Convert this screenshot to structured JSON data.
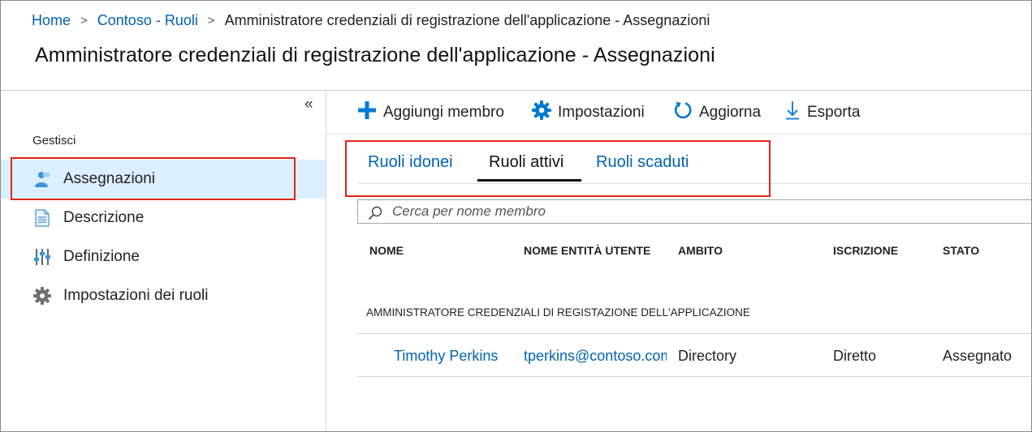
{
  "breadcrumb": {
    "home": "Home",
    "parent": "Contoso - Ruoli",
    "current": "Amministratore credenziali di registrazione dell'applicazione - Assegnazioni",
    "separator": ">"
  },
  "page_title": "Amministratore credenziali di registrazione dell'applicazione - Assegnazioni",
  "sidebar": {
    "collapse_glyph": "«",
    "section": "Gestisci",
    "items": [
      {
        "label": "Assegnazioni",
        "icon": "user-icon",
        "active": true
      },
      {
        "label": "Descrizione",
        "icon": "document-icon",
        "active": false
      },
      {
        "label": "Definizione",
        "icon": "sliders-icon",
        "active": false
      },
      {
        "label": "Impostazioni dei ruoli",
        "icon": "gear-icon",
        "active": false
      }
    ]
  },
  "toolbar": {
    "add_member": "Aggiungi membro",
    "settings": "Impostazioni",
    "refresh": "Aggiorna",
    "export": "Esporta"
  },
  "tabs": {
    "eligible": "Ruoli idonei",
    "active": "Ruoli attivi",
    "expired": "Ruoli scaduti"
  },
  "search": {
    "placeholder": "Cerca per nome membro",
    "value": ""
  },
  "table": {
    "headers": {
      "name": "NOME",
      "upn": "NOME ENTITÀ UTENTE",
      "scope": "AMBITO",
      "membership": "ISCRIZIONE",
      "state": "STATO"
    },
    "group": "AMMINISTRATORE CREDENZIALI DI REGISTAZIONE DELL'APPLICAZIONE",
    "rows": [
      {
        "name": "Timothy Perkins",
        "upn": "tperkins@contoso.com",
        "scope": "Directory",
        "membership": "Diretto",
        "state": "Assegnato"
      }
    ]
  },
  "colors": {
    "link": "#0063b1",
    "accent_blue": "#0078d4",
    "active_nav_bg": "#dcefff",
    "highlight": "#e2231a"
  }
}
